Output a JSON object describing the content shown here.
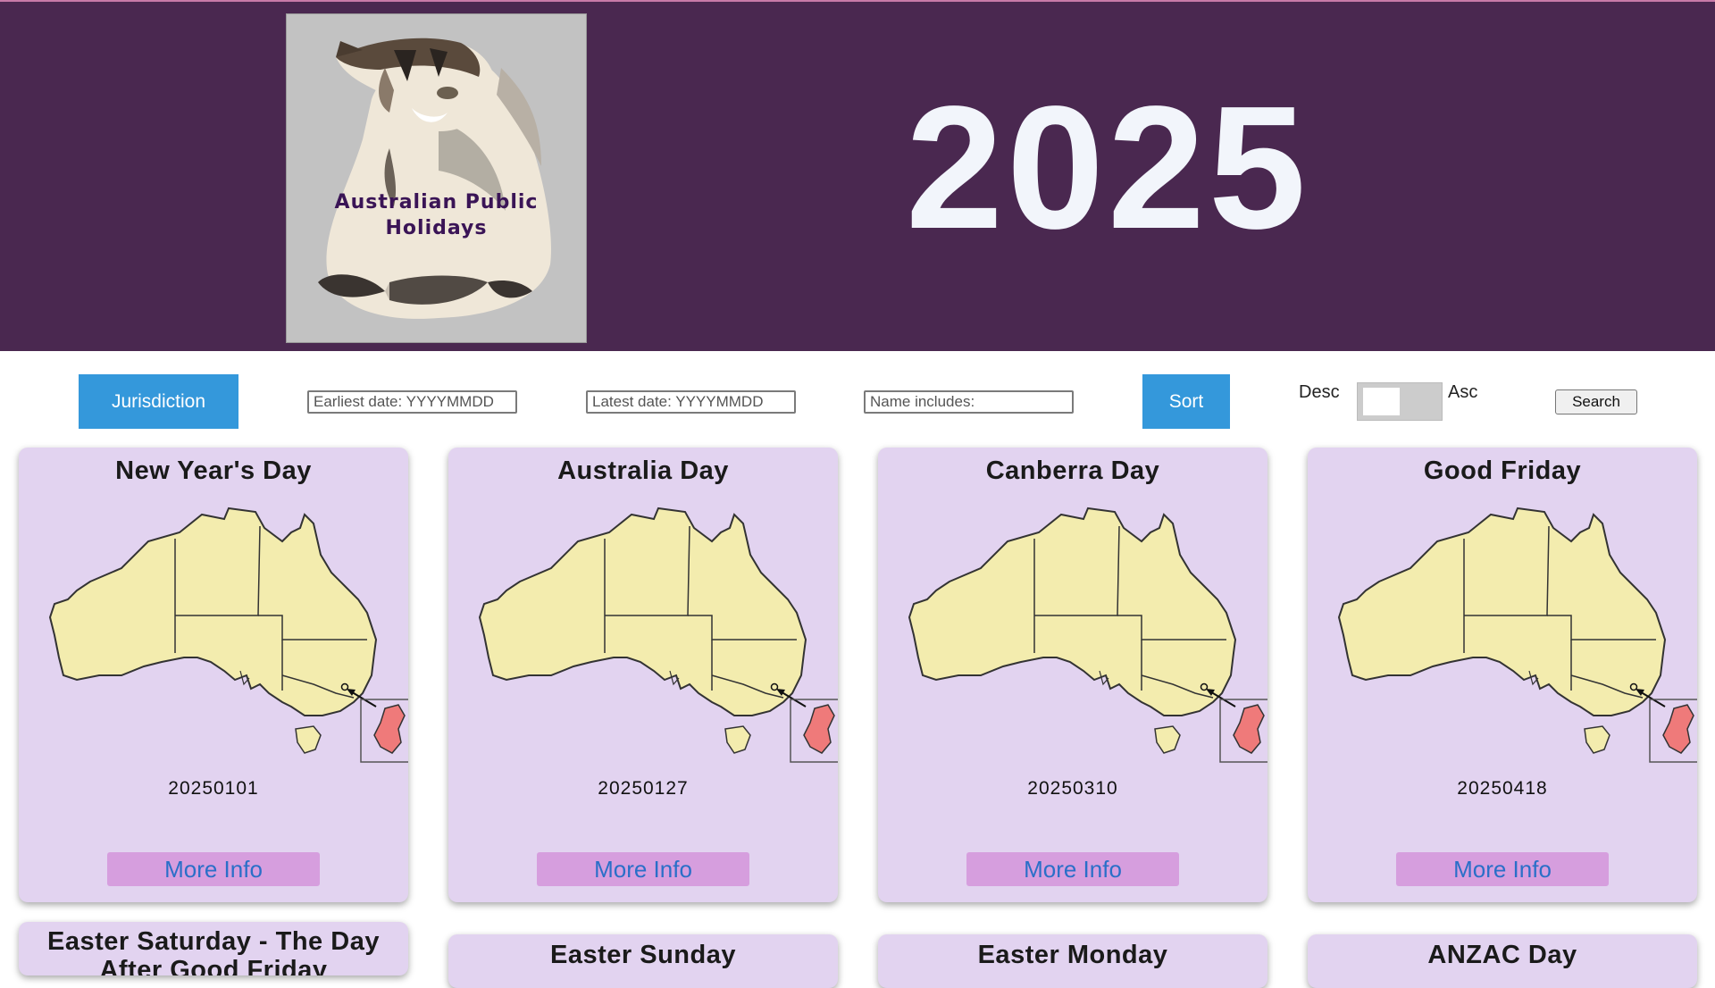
{
  "header": {
    "logo_text_line1": "Australian Public",
    "logo_text_line2": "Holidays",
    "year": "2025",
    "colors": {
      "banner": "#4a2850",
      "year_text": "#f2f5fb",
      "logo_text": "#3a1456"
    }
  },
  "controls": {
    "jurisdiction_label": "Jurisdiction",
    "earliest_placeholder": "Earliest date: YYYYMMDD",
    "latest_placeholder": "Latest date: YYYYMMDD",
    "name_placeholder": "Name includes:",
    "sort_label": "Sort",
    "desc_label": "Desc",
    "asc_label": "Asc",
    "search_label": "Search",
    "colors": {
      "primary_button": "#3498db"
    }
  },
  "holidays": [
    {
      "name": "New Year's Day",
      "date": "20250101",
      "more_label": "More Info"
    },
    {
      "name": "Australia Day",
      "date": "20250127",
      "more_label": "More Info"
    },
    {
      "name": "Canberra Day",
      "date": "20250310",
      "more_label": "More Info"
    },
    {
      "name": "Good Friday",
      "date": "20250418",
      "more_label": "More Info"
    }
  ],
  "holidays_row2": [
    {
      "name_line1": "Easter Saturday - The Day",
      "name_line2": "After Good Friday"
    },
    {
      "name_line1": "Easter Sunday"
    },
    {
      "name_line1": "Easter Monday"
    },
    {
      "name_line1": "ANZAC Day"
    }
  ],
  "card_colors": {
    "card_bg": "#e2d3f0",
    "map_fill": "#f3ecae",
    "highlight_fill": "#ef7a7a",
    "more_button": "#d69ede",
    "more_text": "#2a6fc8"
  }
}
